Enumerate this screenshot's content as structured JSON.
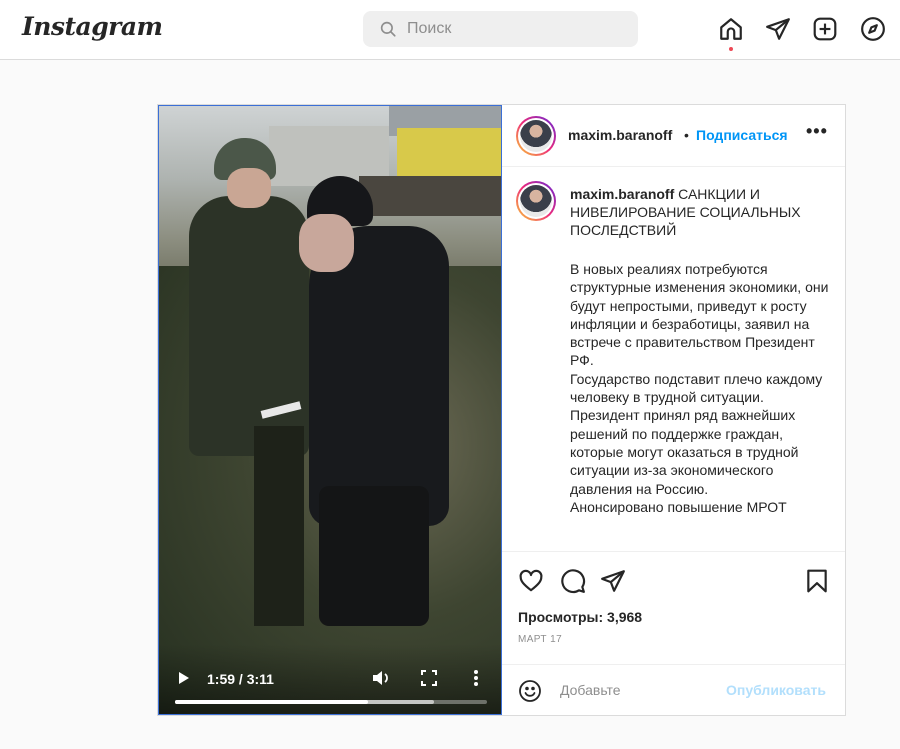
{
  "header": {
    "logo_text": "Instagram",
    "search_placeholder": "Поиск",
    "icons": [
      "home-icon",
      "direct-icon",
      "new-post-icon",
      "explore-icon"
    ],
    "accent_dot_color": "#ed4956"
  },
  "post": {
    "username": "maxim.baranoff",
    "dot": "•",
    "follow_label": "Подписаться",
    "more_label": "•••",
    "caption_title": "САНКЦИИ И НИВЕЛИРОВАНИЕ СОЦИАЛЬНЫХ ПОСЛЕДСТВИЙ",
    "caption_body": "В новых реалиях потребуются структурные изменения экономики, они будут непростыми, приведут к росту инфляции и безработицы, заявил на встрече с правительством Президент РФ.\nГосударство подставит плечо каждому человеку в трудной ситуации. Президент принял ряд важнейших решений по поддержке граждан, которые могут оказаться в трудной ситуации из-за экономического давления на Россию.\nАнонсировано повышение МРОТ",
    "views_label": "Просмотры: 3,968",
    "date_label": "МАРТ 17",
    "comment_placeholder": "Добавьте",
    "publish_label": "Опубликовать",
    "follow_color": "#0095f6"
  },
  "video": {
    "time_label": "1:59 / 3:11",
    "progress_fraction": 0.62,
    "buffered_fraction": 0.83
  }
}
